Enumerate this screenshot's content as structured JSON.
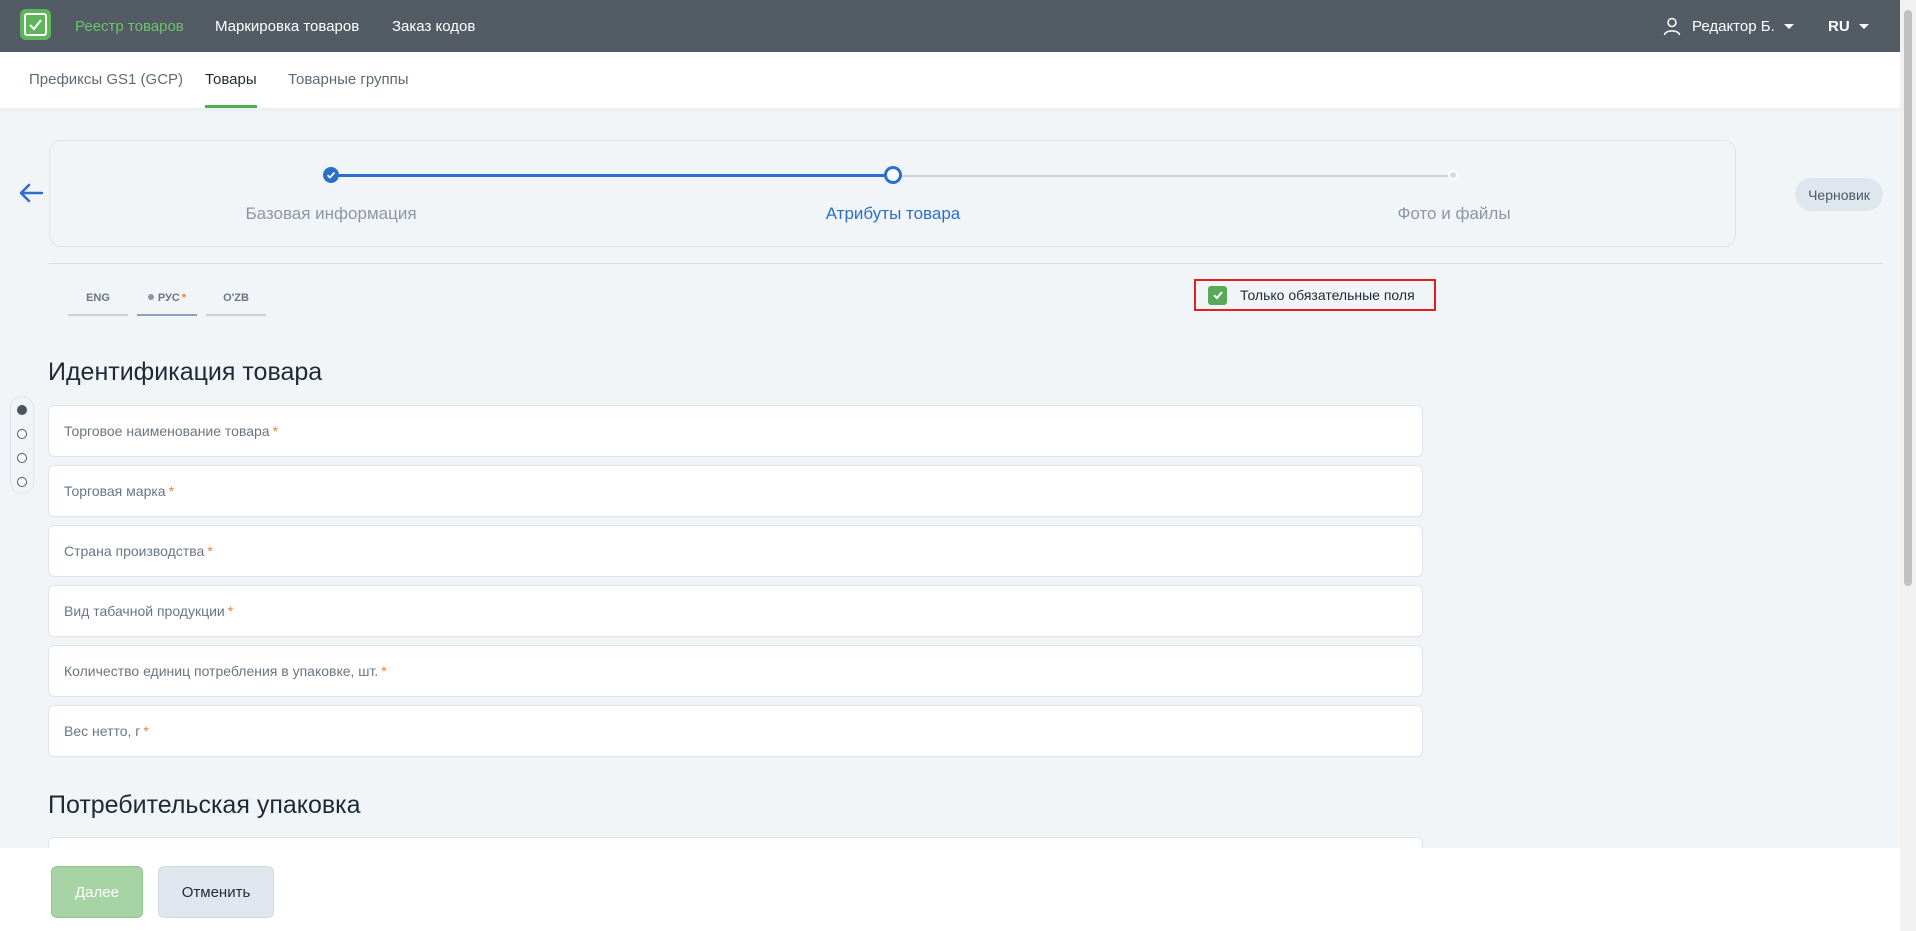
{
  "topbar": {
    "nav": [
      "Реестр товаров",
      "Маркировка товаров",
      "Заказ кодов"
    ],
    "user": "Редактор Б.",
    "lang": "RU"
  },
  "subnav": [
    "Префиксы GS1 (GCP)",
    "Товары",
    "Товарные группы"
  ],
  "stepper": {
    "steps": [
      "Базовая информация",
      "Атрибуты товара",
      "Фото и файлы"
    ],
    "current": 1
  },
  "status_badge": "Черновик",
  "lang_tabs": [
    {
      "label": "ENG"
    },
    {
      "label": "РУС",
      "required_mark": "*"
    },
    {
      "label": "O'ZB"
    }
  ],
  "only_required": {
    "label": "Только обязательные поля",
    "checked": true
  },
  "sections": [
    {
      "title": "Идентификация товара",
      "fields": [
        {
          "label": "Торговое наименование товара",
          "req": "*"
        },
        {
          "label": "Торговая марка",
          "req": "*"
        },
        {
          "label": "Страна производства",
          "req": "*"
        },
        {
          "label": "Вид табачной продукции",
          "req": "*"
        },
        {
          "label": "Количество единиц потребления в упаковке, шт.",
          "req": "*"
        },
        {
          "label": "Вес нетто, г",
          "req": "*"
        }
      ]
    },
    {
      "title": "Потребительская упаковка",
      "fields": []
    }
  ],
  "actions": {
    "next": "Далее",
    "cancel": "Отменить"
  }
}
